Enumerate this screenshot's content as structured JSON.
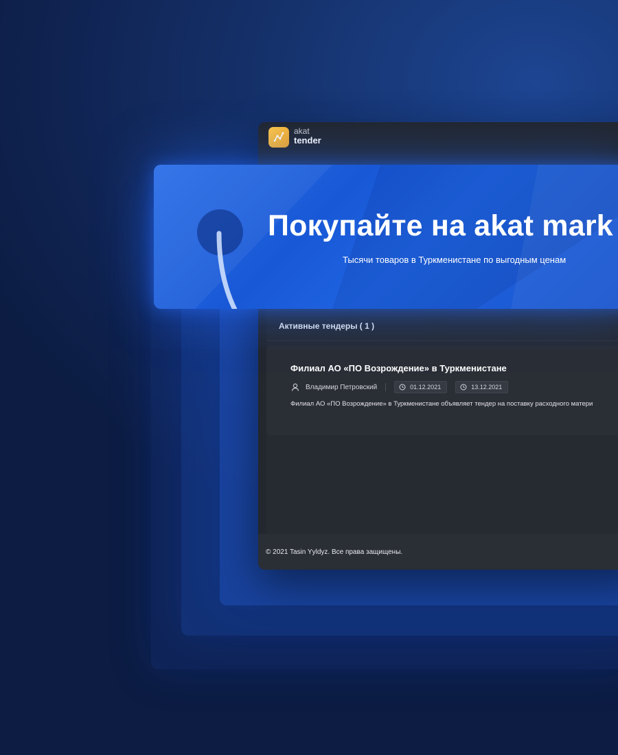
{
  "brand": {
    "line1": "akat",
    "line2": "tender",
    "logo_color": "#f7b532"
  },
  "banner": {
    "title": "Покупайте на akat mark",
    "subtitle": "Тысячи товаров в Туркменистане по выгодным ценам",
    "color": "#1f63e0"
  },
  "tenders": {
    "section_title": "Активные тендеры ( 1 )",
    "items": [
      {
        "title": "Филиал АО «ПО Возрождение» в Туркменистане",
        "author": "Владимир Петровский",
        "start_date": "01.12.2021",
        "end_date": "13.12.2021",
        "description": "Филиал АО «ПО Возрождение» в Туркменистане объявляет тендер на поставку расходного матери"
      }
    ]
  },
  "footer": {
    "copyright": "© 2021 Tasin Yyldyz. Все права защищены."
  },
  "icons": {
    "logo": "chart-line-icon",
    "author": "user-icon",
    "date": "clock-icon"
  }
}
